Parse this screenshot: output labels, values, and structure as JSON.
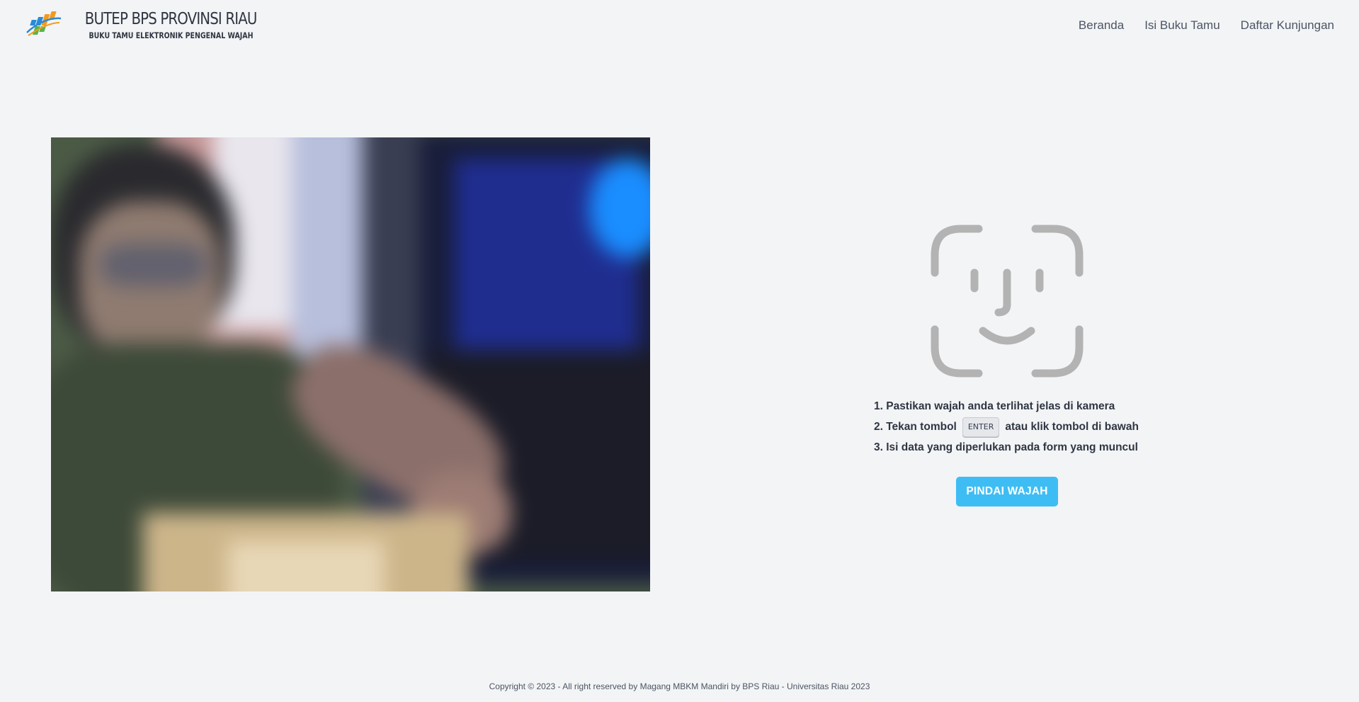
{
  "header": {
    "brand_title": "BUTEP BPS PROVINSI RIAU",
    "brand_subtitle": "BUKU TAMU ELEKTRONIK PENGENAL WAJAH",
    "logo_icon": "bps-logo-icon",
    "nav": {
      "home": "Beranda",
      "guestbook": "Isi Buku Tamu",
      "visits": "Daftar Kunjungan"
    }
  },
  "camera": {
    "feed": "live-camera-feed"
  },
  "scan": {
    "icon": "face-id-icon",
    "step1": "1. Pastikan wajah anda terlihat jelas di kamera",
    "step2_before": "2. Tekan tombol",
    "step2_key": "ENTER",
    "step2_after": "atau klik tombol di bawah",
    "step3": "3. Isi data yang diperlukan pada form yang muncul",
    "button_label": "PINDAI WAJAH"
  },
  "footer": {
    "copyright": "Copyright © 2023 - All right reserved by Magang MBKM Mandiri by BPS Riau - Universitas Riau 2023"
  },
  "colors": {
    "background": "#f3f4f6",
    "accent": "#3ebdf4",
    "text": "#2f3642",
    "icon": "#b3b3b3"
  }
}
